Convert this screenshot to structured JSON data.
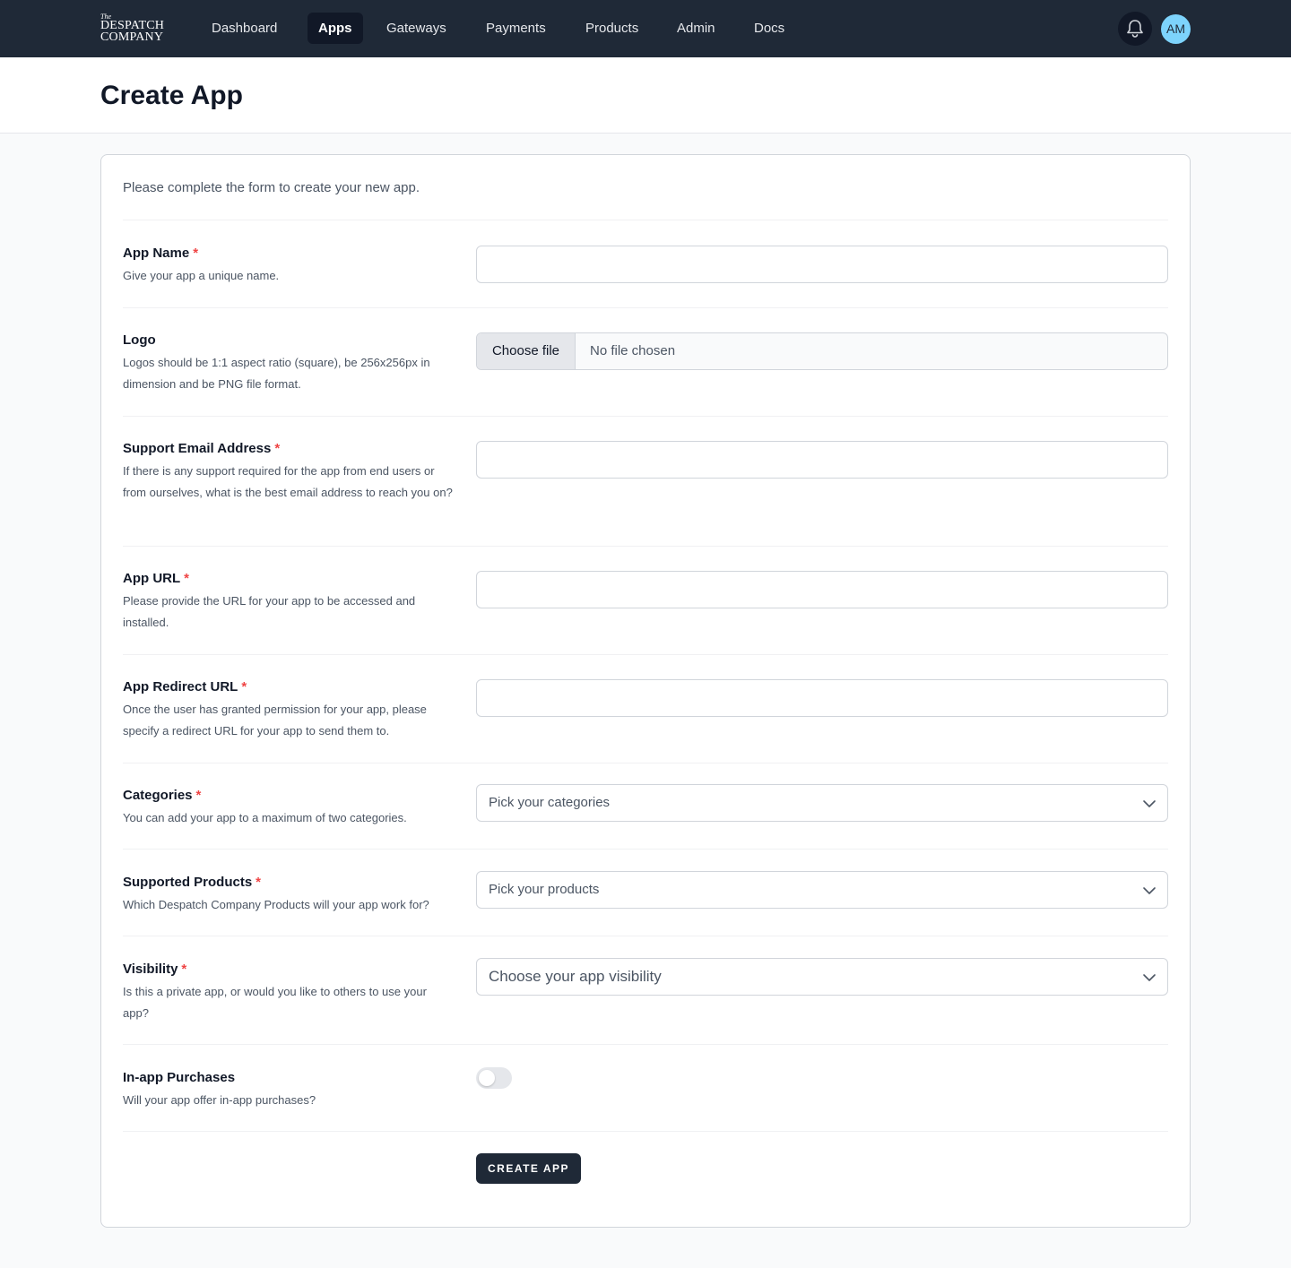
{
  "brand": {
    "line_small": "The",
    "line1": "DESPATCH",
    "line2": "COMPANY"
  },
  "nav": {
    "items": [
      {
        "label": "Dashboard",
        "active": false
      },
      {
        "label": "Apps",
        "active": true
      },
      {
        "label": "Gateways",
        "active": false
      },
      {
        "label": "Payments",
        "active": false
      },
      {
        "label": "Products",
        "active": false
      },
      {
        "label": "Admin",
        "active": false
      },
      {
        "label": "Docs",
        "active": false
      }
    ],
    "avatar_initials": "AM",
    "icons": {
      "notifications": "bell-icon"
    }
  },
  "page": {
    "title": "Create App"
  },
  "form": {
    "intro": "Please complete the form to create your new app.",
    "required_marker": "*",
    "app_name": {
      "label": "App Name",
      "help": "Give your app a unique name.",
      "value": ""
    },
    "logo": {
      "label": "Logo",
      "help": "Logos should be 1:1 aspect ratio (square), be 256x256px in dimension and be PNG file format.",
      "button": "Choose file",
      "status": "No file chosen"
    },
    "support_email": {
      "label": "Support Email Address",
      "help": "If there is any support required for the app from end users or from ourselves, what is the best email address to reach you on?",
      "value": ""
    },
    "app_url": {
      "label": "App URL",
      "help": "Please provide the URL for your app to be accessed and installed.",
      "value": ""
    },
    "redirect_url": {
      "label": "App Redirect URL",
      "help": "Once the user has granted permission for your app, please specify a redirect URL for your app to send them to.",
      "value": ""
    },
    "categories": {
      "label": "Categories",
      "help": "You can add your app to a maximum of two categories.",
      "placeholder": "Pick your categories"
    },
    "products": {
      "label": "Supported Products",
      "help": "Which Despatch Company Products will your app work for?",
      "placeholder": "Pick your products"
    },
    "visibility": {
      "label": "Visibility",
      "help": "Is this a private app, or would you like to others to use your app?",
      "placeholder": "Choose your app visibility"
    },
    "in_app_purchases": {
      "label": "In-app Purchases",
      "help": "Will your app offer in-app purchases?",
      "enabled": false
    },
    "submit": "CREATE APP"
  },
  "colors": {
    "nav_bg": "#1f2937",
    "active_tab": "#111827",
    "required": "#ef4444",
    "avatar": "#7dd3fc",
    "button": "#1f2937"
  }
}
